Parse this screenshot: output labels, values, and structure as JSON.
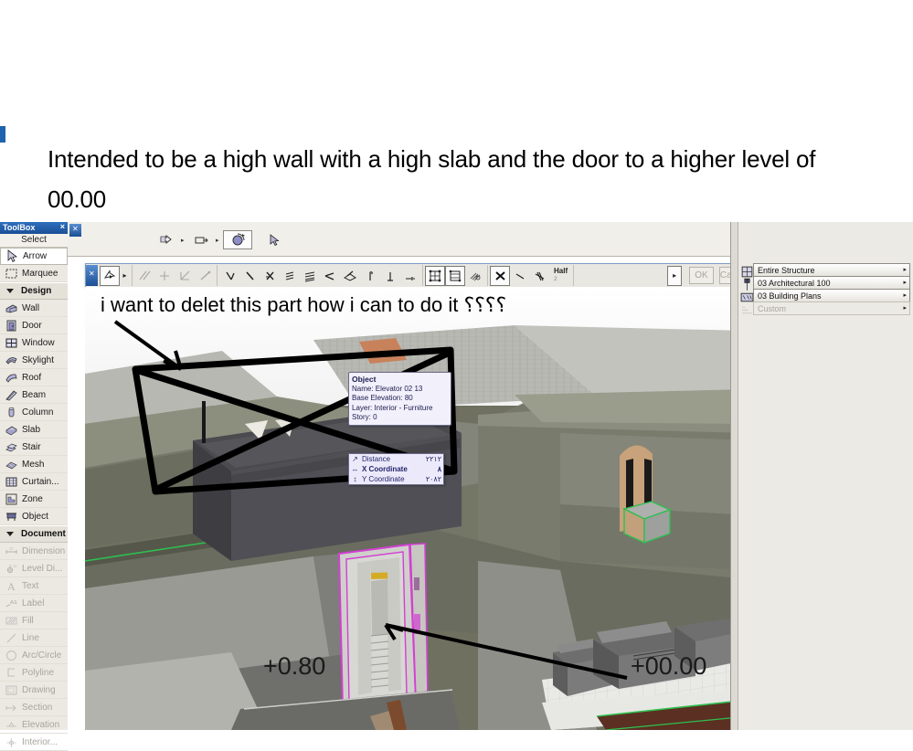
{
  "post": {
    "intro_text": "Intended to be a high wall with a high slab and the door to a higher level of 00.00",
    "annotation_text": "i want to delet this part how i can to do it ؟؟؟؟"
  },
  "toolbox": {
    "title": "ToolBox",
    "close_label": "×",
    "subtitle": "Select",
    "items": [
      {
        "label": "Arrow",
        "icon": "arrow-icon",
        "state": "selected",
        "group": false
      },
      {
        "label": "Marquee",
        "icon": "marquee-icon",
        "state": "normal",
        "group": false
      },
      {
        "label": "Design",
        "icon": "triangle-down-icon",
        "state": "normal",
        "group": true
      },
      {
        "label": "Wall",
        "icon": "wall-icon",
        "state": "normal",
        "group": false
      },
      {
        "label": "Door",
        "icon": "door-icon",
        "state": "normal",
        "group": false
      },
      {
        "label": "Window",
        "icon": "window-icon",
        "state": "normal",
        "group": false
      },
      {
        "label": "Skylight",
        "icon": "skylight-icon",
        "state": "normal",
        "group": false
      },
      {
        "label": "Roof",
        "icon": "roof-icon",
        "state": "normal",
        "group": false
      },
      {
        "label": "Beam",
        "icon": "beam-icon",
        "state": "normal",
        "group": false
      },
      {
        "label": "Column",
        "icon": "column-icon",
        "state": "normal",
        "group": false
      },
      {
        "label": "Slab",
        "icon": "slab-icon",
        "state": "normal",
        "group": false
      },
      {
        "label": "Stair",
        "icon": "stair-icon",
        "state": "normal",
        "group": false
      },
      {
        "label": "Mesh",
        "icon": "mesh-icon",
        "state": "normal",
        "group": false
      },
      {
        "label": "Curtain...",
        "icon": "curtain-wall-icon",
        "state": "normal",
        "group": false
      },
      {
        "label": "Zone",
        "icon": "zone-icon",
        "state": "normal",
        "group": false
      },
      {
        "label": "Object",
        "icon": "object-icon",
        "state": "normal",
        "group": false
      },
      {
        "label": "Document",
        "icon": "triangle-down-icon",
        "state": "normal",
        "group": true
      },
      {
        "label": "Dimension",
        "icon": "dimension-icon",
        "state": "disabled",
        "group": false
      },
      {
        "label": "Level Di...",
        "icon": "level-dimension-icon",
        "state": "disabled",
        "group": false
      },
      {
        "label": "Text",
        "icon": "text-icon",
        "state": "disabled",
        "group": false
      },
      {
        "label": "Label",
        "icon": "label-icon",
        "state": "disabled",
        "group": false
      },
      {
        "label": "Fill",
        "icon": "fill-icon",
        "state": "disabled",
        "group": false
      },
      {
        "label": "Line",
        "icon": "line-icon",
        "state": "disabled",
        "group": false
      },
      {
        "label": "Arc/Circle",
        "icon": "arc-circle-icon",
        "state": "disabled",
        "group": false
      },
      {
        "label": "Polyline",
        "icon": "polyline-icon",
        "state": "disabled",
        "group": false
      },
      {
        "label": "Drawing",
        "icon": "drawing-icon",
        "state": "disabled",
        "group": false
      },
      {
        "label": "Section",
        "icon": "section-icon",
        "state": "disabled",
        "group": false
      },
      {
        "label": "Elevation",
        "icon": "elevation-icon",
        "state": "disabled",
        "group": false
      },
      {
        "label": "Interior...",
        "icon": "interior-elevation-icon",
        "state": "disabled",
        "group": false
      }
    ]
  },
  "mini_toolbar": {
    "buttons": [
      {
        "name": "section-tool-icon",
        "caret": true
      },
      {
        "name": "marquee-tool-icon",
        "caret": true
      },
      {
        "name": "orbit-tool-icon",
        "caret": false,
        "state": "pressed"
      },
      {
        "name": "arrow-tool-icon",
        "caret": false
      }
    ]
  },
  "pet_palette": {
    "half_label": "Half",
    "half_sub": "2",
    "ok_label": "OK",
    "cancel_label": "Cancel",
    "groups": [
      [
        "polygon-select-icon",
        "more-icon"
      ],
      [
        "parallel-icon",
        "perpendicular-offset-icon",
        "angle-bisector-icon",
        "offset-line-icon"
      ],
      [
        "snap-point-icon",
        "snap-line-icon",
        "snap-intersect-icon",
        "snap-special-icon",
        "snap-special2-icon",
        "snap-tangent-icon",
        "snap-surface-icon",
        "snap-height-icon",
        "snap-perp-icon",
        "snap-plus-icon"
      ],
      [
        "grid-snap-icon",
        "grid-snap-alt-icon",
        "gravity-icon"
      ],
      [
        "cancel-guide-icon",
        "guide-line-icon",
        "guide-lines-off-icon"
      ]
    ]
  },
  "right_panel": {
    "rows": [
      {
        "label": "Entire Structure",
        "icon": "structure-icon",
        "state": "normal",
        "arrow": "▸"
      },
      {
        "label": "03 Architectural 100",
        "icon": "layer-icon",
        "state": "normal",
        "arrow": "▸"
      },
      {
        "label": "03 Building Plans",
        "icon": "pen-set-icon",
        "state": "normal",
        "arrow": "▸"
      },
      {
        "label": "Custom",
        "icon": "custom-icon",
        "state": "disabled",
        "arrow": "▸"
      }
    ]
  },
  "object_tooltip": {
    "title": "Object",
    "lines": [
      "Name: Elevator 02 13",
      "Base Elevation: 80",
      "Layer: Interior  - Furniture",
      "Story: 0"
    ]
  },
  "coordinate_tracker": {
    "rows": [
      {
        "icon": "↗",
        "label": "Distance",
        "value": "٢٢١٢",
        "bold": false
      },
      {
        "icon": "↔",
        "label": "X Coordinate",
        "value": "٨",
        "bold": true
      },
      {
        "icon": "↕",
        "label": "Y Coordinate",
        "value": "٢٠٨٢",
        "bold": false
      }
    ]
  },
  "scene": {
    "elevation_left": "+0.80",
    "elevation_right": "+00.00"
  },
  "colors": {
    "title_bar_blue": "#1b4f96",
    "palette_bg": "#ece9e2",
    "wall_green_grey": "#6f7060",
    "selection_magenta": "#d33fd3",
    "selection_green": "#2fbf4f",
    "annotation_black": "#000000"
  }
}
